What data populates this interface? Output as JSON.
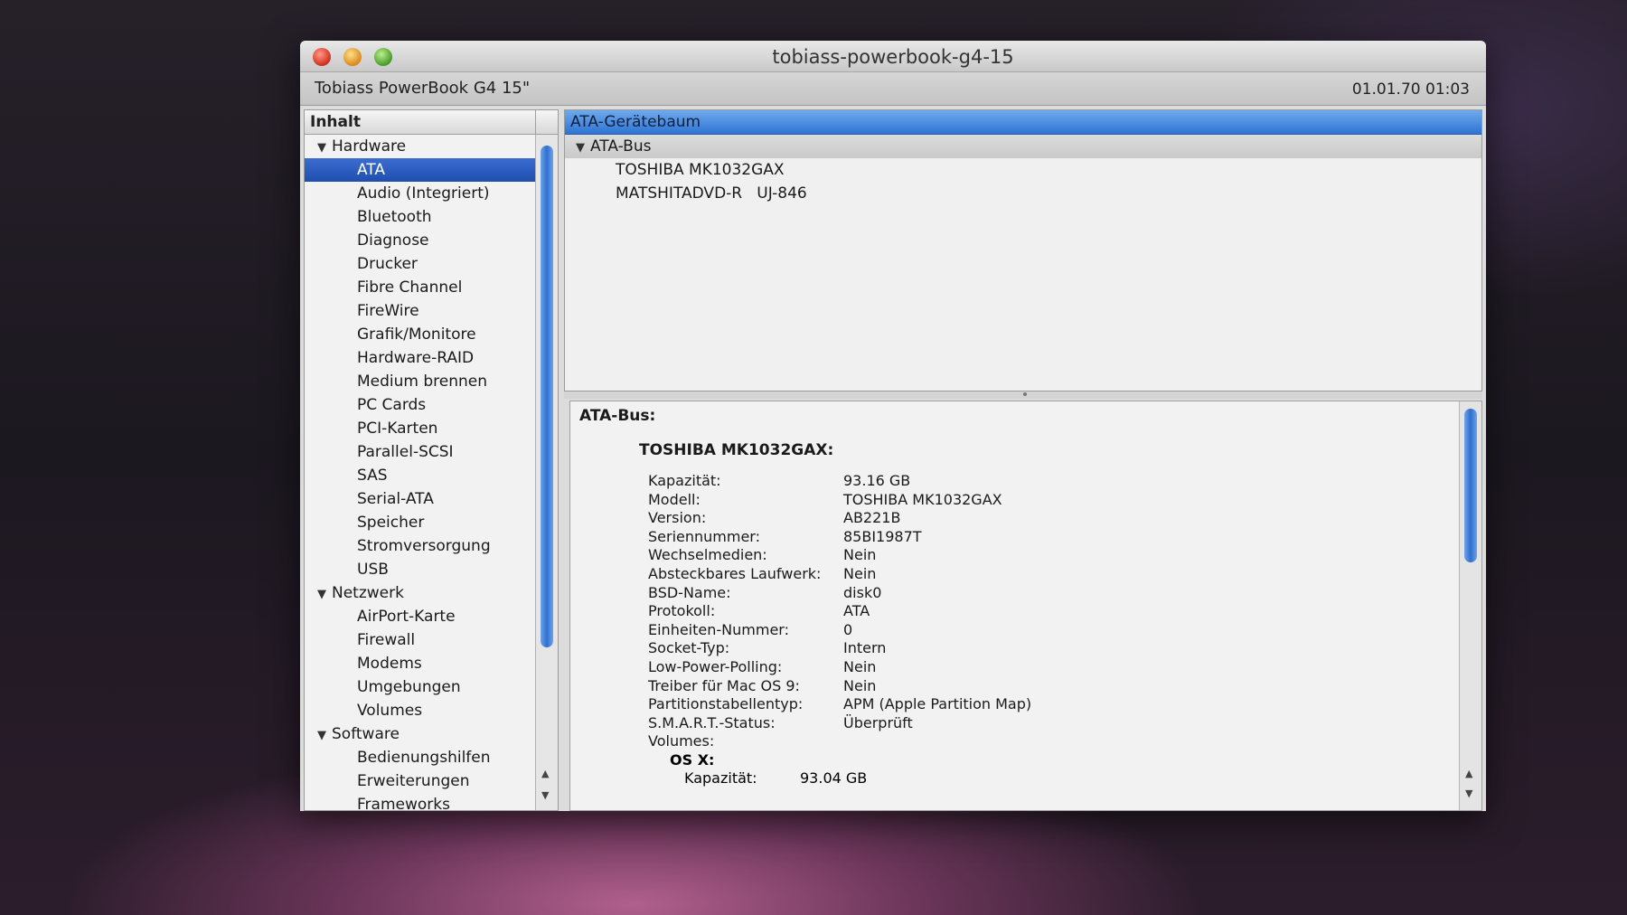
{
  "window": {
    "title": "tobiass-powerbook-g4-15",
    "machine_name": "Tobiass PowerBook G4 15\"",
    "datetime": "01.01.70 01:03"
  },
  "sidebar": {
    "header": "Inhalt",
    "groups": [
      {
        "label": "Hardware",
        "items": [
          "ATA",
          "Audio (Integriert)",
          "Bluetooth",
          "Diagnose",
          "Drucker",
          "Fibre Channel",
          "FireWire",
          "Grafik/Monitore",
          "Hardware-RAID",
          "Medium brennen",
          "PC Cards",
          "PCI-Karten",
          "Parallel-SCSI",
          "SAS",
          "Serial-ATA",
          "Speicher",
          "Stromversorgung",
          "USB"
        ]
      },
      {
        "label": "Netzwerk",
        "items": [
          "AirPort-Karte",
          "Firewall",
          "Modems",
          "Umgebungen",
          "Volumes"
        ]
      },
      {
        "label": "Software",
        "items": [
          "Bedienungshilfen",
          "Erweiterungen",
          "Frameworks"
        ]
      }
    ],
    "selected": "ATA"
  },
  "tree": {
    "header": "ATA-Gerätebaum",
    "bus": "ATA-Bus",
    "devices": [
      "TOSHIBA MK1032GAX",
      "MATSHITADVD-R   UJ-846"
    ]
  },
  "detail": {
    "bus_label": "ATA-Bus:",
    "device_label": "TOSHIBA MK1032GAX:",
    "properties": [
      {
        "key": "Kapazität:",
        "value": "93.16 GB"
      },
      {
        "key": "Modell:",
        "value": "TOSHIBA MK1032GAX"
      },
      {
        "key": "Version:",
        "value": "AB221B"
      },
      {
        "key": "Seriennummer:",
        "value": "85BI1987T"
      },
      {
        "key": "Wechselmedien:",
        "value": "Nein"
      },
      {
        "key": "Absteckbares Laufwerk:",
        "value": "Nein"
      },
      {
        "key": "BSD-Name:",
        "value": "disk0"
      },
      {
        "key": "Protokoll:",
        "value": "ATA"
      },
      {
        "key": "Einheiten-Nummer:",
        "value": "0"
      },
      {
        "key": "Socket-Typ:",
        "value": "Intern"
      },
      {
        "key": "Low-Power-Polling:",
        "value": "Nein"
      },
      {
        "key": "Treiber für Mac OS 9:",
        "value": "Nein"
      },
      {
        "key": "Partitionstabellentyp:",
        "value": "APM (Apple Partition Map)"
      },
      {
        "key": "S.M.A.R.T.-Status:",
        "value": "Überprüft"
      },
      {
        "key": "Volumes:",
        "value": ""
      }
    ],
    "volume_name": "OS X:",
    "volume_props": [
      {
        "key": "Kapazität:",
        "value": "93.04 GB"
      }
    ]
  }
}
